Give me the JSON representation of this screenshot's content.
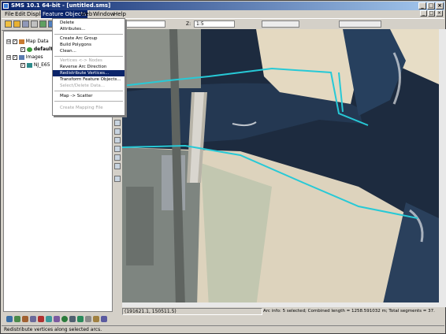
{
  "window": {
    "title": "SMS 10.1 64-bit - [untitled.sms]",
    "minimize_glyph": "_",
    "maximize_glyph": "□",
    "close_glyph": "×"
  },
  "menubar": {
    "items": [
      "File",
      "Edit",
      "Display",
      "Feature Objects",
      "Web",
      "Window",
      "Help"
    ],
    "active": "Feature Objects"
  },
  "toolbar": {
    "z_label": "Z:",
    "scale_value": "1:5"
  },
  "tree": {
    "map_data": "Map Data",
    "default_coverage": "default",
    "images": "Images",
    "image_item": "NJ_E65"
  },
  "feature_menu": {
    "items": [
      {
        "label": "Delete",
        "disabled": false,
        "highlighted": false
      },
      {
        "label": "Attributes...",
        "disabled": false,
        "highlighted": false
      },
      {
        "label": "Create Arc Group",
        "disabled": false,
        "highlighted": false
      },
      {
        "label": "Build Polygons",
        "disabled": false,
        "highlighted": false
      },
      {
        "label": "Clean...",
        "disabled": false,
        "highlighted": false
      },
      {
        "label": "Vertices <-> Nodes",
        "disabled": true,
        "highlighted": false
      },
      {
        "label": "Reverse Arc Direction",
        "disabled": false,
        "highlighted": false
      },
      {
        "label": "Redistribute Vertices...",
        "disabled": false,
        "highlighted": true
      },
      {
        "label": "Transform Feature Objects...",
        "disabled": false,
        "highlighted": false
      },
      {
        "label": "Select/Delete Data...",
        "disabled": true,
        "highlighted": false
      },
      {
        "label": "Map -> Scatter",
        "disabled": false,
        "highlighted": false
      },
      {
        "label": "Create Mapping File",
        "disabled": true,
        "highlighted": false
      }
    ]
  },
  "status": {
    "coords": "(191621.1, 150511.5)",
    "arc_info": "Arc info: 5 selected; Combined length = 1258.591032 m; Total segments = 37.",
    "help_text": "Redistribute vertices along selected arcs."
  },
  "colors": {
    "title_start": "#0a246a",
    "title_end": "#a6caf0",
    "highlight": "#0a246a",
    "arc_selected": "#27c9d6",
    "water": "#1d2b3f",
    "sand": "#ddd3bd"
  },
  "icons": {
    "tree_expander": "⊟",
    "checkbox_checked": "✓"
  }
}
